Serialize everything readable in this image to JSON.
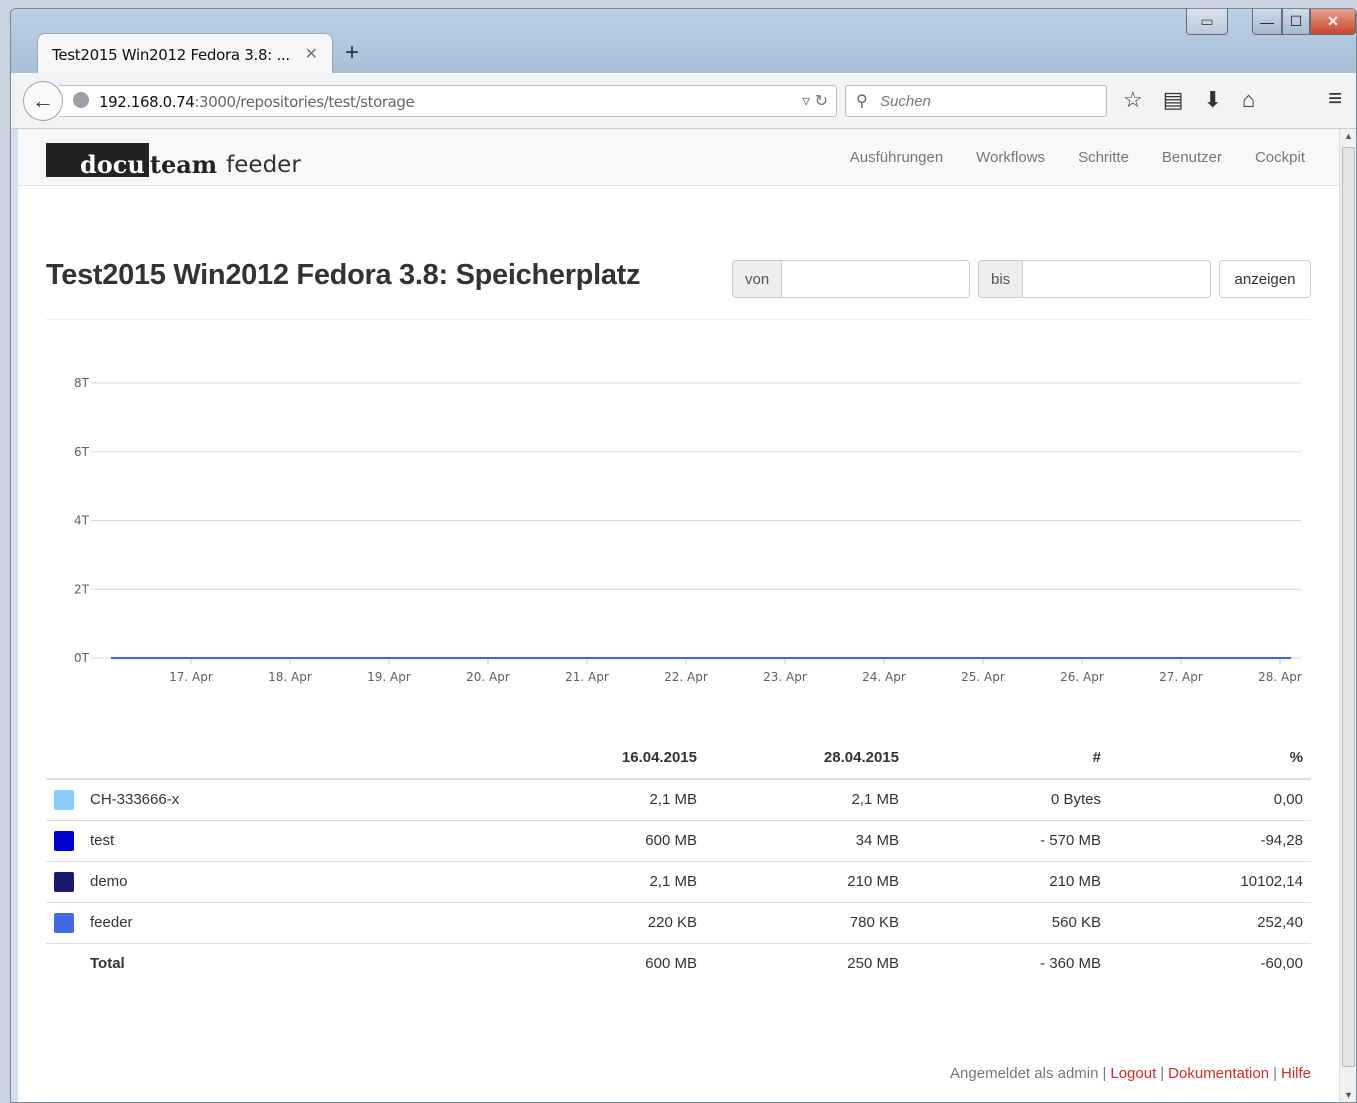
{
  "browser": {
    "tab_title": "Test2015 Win2012 Fedora 3.8: ...",
    "tab_close": "✕",
    "new_tab": "+",
    "url_host": "192.168.0.74",
    "url_path": ":3000/repositories/test/storage",
    "search_placeholder": "Suchen"
  },
  "app": {
    "logo_docu": "docu",
    "logo_team": "team",
    "logo_feeder": "feeder",
    "nav": [
      "Ausführungen",
      "Workflows",
      "Schritte",
      "Benutzer",
      "Cockpit"
    ]
  },
  "page": {
    "title": "Test2015 Win2012 Fedora 3.8: Speicherplatz",
    "from_label": "von",
    "to_label": "bis",
    "from_value": "",
    "to_value": "",
    "show_button": "anzeigen"
  },
  "chart_data": {
    "type": "line",
    "x": [
      "17. Apr",
      "18. Apr",
      "19. Apr",
      "20. Apr",
      "21. Apr",
      "22. Apr",
      "23. Apr",
      "24. Apr",
      "25. Apr",
      "26. Apr",
      "27. Apr",
      "28. Apr"
    ],
    "y_ticks": [
      "0T",
      "2T",
      "4T",
      "6T",
      "8T"
    ],
    "ylim": [
      0,
      8
    ],
    "grid": true,
    "series": [
      {
        "name": "CH-333666-x",
        "color": "#87cefa",
        "values": [
          0,
          0,
          0,
          0,
          0,
          0,
          0,
          0,
          0,
          0,
          0,
          0
        ]
      },
      {
        "name": "test",
        "color": "#0000cd",
        "values": [
          0,
          0,
          0,
          0,
          0,
          0,
          0,
          0,
          0,
          0,
          0,
          0
        ]
      },
      {
        "name": "demo",
        "color": "#191970",
        "values": [
          0,
          0,
          0,
          0,
          0,
          0,
          0,
          0,
          0,
          0,
          0,
          0
        ]
      },
      {
        "name": "feeder",
        "color": "#4169e1",
        "values": [
          0,
          0,
          0,
          0,
          0,
          0,
          0,
          0,
          0,
          0,
          0,
          0
        ]
      }
    ]
  },
  "table": {
    "headers": [
      "",
      "",
      "16.04.2015",
      "28.04.2015",
      "#",
      "%"
    ],
    "rows": [
      {
        "color": "#87cefa",
        "name": "CH-333666-x",
        "start": "2,1 MB",
        "end": "2,1 MB",
        "diff": "0 Bytes",
        "pct": "0,00"
      },
      {
        "color": "#0000cd",
        "name": "test",
        "start": "600 MB",
        "end": "34 MB",
        "diff": "- 570 MB",
        "pct": "-94,28"
      },
      {
        "color": "#191970",
        "name": "demo",
        "start": "2,1 MB",
        "end": "210 MB",
        "diff": "210 MB",
        "pct": "10102,14"
      },
      {
        "color": "#4169e1",
        "name": "feeder",
        "start": "220 KB",
        "end": "780 KB",
        "diff": "560 KB",
        "pct": "252,40"
      }
    ],
    "total": {
      "name": "Total",
      "start": "600 MB",
      "end": "250 MB",
      "diff": "- 360 MB",
      "pct": "-60,00"
    }
  },
  "footer": {
    "logged_in": "Angemeldet als admin",
    "logout": "Logout",
    "docs": "Dokumentation",
    "help": "Hilfe",
    "sep": "|"
  }
}
